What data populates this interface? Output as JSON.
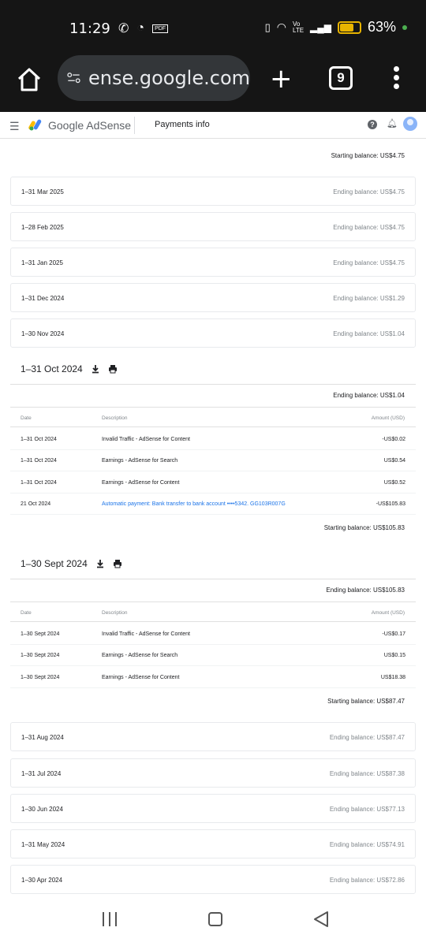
{
  "status": {
    "time": "11:29",
    "battery": "63%",
    "pdf_label": "PDF",
    "volte": "Vo LTE"
  },
  "browser": {
    "url": "ense.google.com",
    "tab_count": "9"
  },
  "app": {
    "brand": "Google AdSense",
    "page": "Payments info"
  },
  "top_starting_balance": "Starting balance: US$4.75",
  "months_top": [
    {
      "date": "1–31 Mar 2025",
      "balance": "Ending balance: US$4.75"
    },
    {
      "date": "1–28 Feb 2025",
      "balance": "Ending balance: US$4.75"
    },
    {
      "date": "1–31 Jan 2025",
      "balance": "Ending balance: US$4.75"
    },
    {
      "date": "1–31 Dec 2024",
      "balance": "Ending balance: US$1.29"
    },
    {
      "date": "1–30 Nov 2024",
      "balance": "Ending balance: US$1.04"
    }
  ],
  "oct": {
    "title": "1–31 Oct 2024",
    "ending": "Ending balance: US$1.04",
    "headers": {
      "date": "Date",
      "description": "Description",
      "amount": "Amount (USD)"
    },
    "rows": [
      {
        "date": "1–31 Oct 2024",
        "desc": "Invalid Traffic - AdSense for Content",
        "amount": "-US$0.02"
      },
      {
        "date": "1–31 Oct 2024",
        "desc": "Earnings - AdSense for Search",
        "amount": "US$0.54"
      },
      {
        "date": "1–31 Oct 2024",
        "desc": "Earnings - AdSense for Content",
        "amount": "US$0.52"
      },
      {
        "date": "21 Oct 2024",
        "desc": "Automatic payment: Bank transfer to bank account ••••5342. GG103R007G",
        "amount": "-US$105.83"
      }
    ],
    "starting": "Starting balance: US$105.83"
  },
  "sept": {
    "title": "1–30 Sept 2024",
    "ending": "Ending balance: US$105.83",
    "headers": {
      "date": "Date",
      "description": "Description",
      "amount": "Amount (USD)"
    },
    "rows": [
      {
        "date": "1–30 Sept 2024",
        "desc": "Invalid Traffic - AdSense for Content",
        "amount": "-US$0.17"
      },
      {
        "date": "1–30 Sept 2024",
        "desc": "Earnings - AdSense for Search",
        "amount": "US$0.15"
      },
      {
        "date": "1–30 Sept 2024",
        "desc": "Earnings - AdSense for Content",
        "amount": "US$18.38"
      }
    ],
    "starting": "Starting balance: US$87.47"
  },
  "months_bottom": [
    {
      "date": "1–31 Aug 2024",
      "balance": "Ending balance: US$87.47"
    },
    {
      "date": "1–31 Jul 2024",
      "balance": "Ending balance: US$87.38"
    },
    {
      "date": "1–30 Jun 2024",
      "balance": "Ending balance: US$77.13"
    },
    {
      "date": "1–31 May 2024",
      "balance": "Ending balance: US$74.91"
    },
    {
      "date": "1–30 Apr 2024",
      "balance": "Ending balance: US$72.86"
    }
  ],
  "icons": [
    "home-icon",
    "site-settings-icon",
    "new-tab-icon",
    "tabs-icon",
    "more-icon",
    "menu-icon",
    "help-icon",
    "notifications-icon",
    "download-icon",
    "print-icon"
  ]
}
